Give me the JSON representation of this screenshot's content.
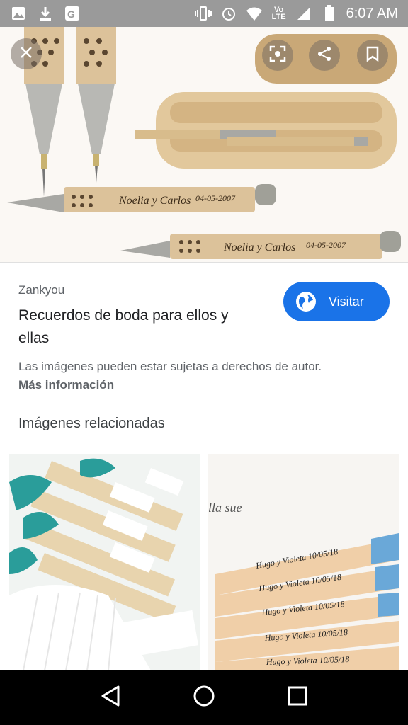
{
  "status_bar": {
    "time": "6:07 AM",
    "icons_left": [
      "image-icon",
      "download-icon",
      "google-settings-icon"
    ],
    "icons_right": [
      "vibrate-icon",
      "alarm-icon",
      "wifi-icon",
      "volte-icon",
      "signal-icon",
      "battery-icon"
    ],
    "volte_label": "Vo LTE"
  },
  "hero": {
    "engraving_1": "Noelia y Carlos",
    "date_1": "04-05-2007",
    "engraving_2": "Noelia y Carlos",
    "date_2": "04-05-2007"
  },
  "result": {
    "source": "Zankyou",
    "title": "Recuerdos de boda para ellos y ellas",
    "visit_label": "Visitar",
    "copyright": "Las imágenes pueden estar sujetas a derechos de autor.",
    "more_info": "Más información"
  },
  "related": {
    "heading": "Imágenes relacionadas",
    "thumb2_text": "lla sue",
    "fan_labels": [
      "Hugo y Violeta  10/05/18",
      "Hugo y Violeta  10/05/18",
      "Hugo y Violeta  10/05/18",
      "Hugo y Violeta  10/05/18",
      "Hugo y Violeta  10/05/18"
    ]
  },
  "colors": {
    "accent": "#1a73e8",
    "status_bar": "#9a9a9a",
    "nav_bar": "#000000",
    "wood": "#dcc29a",
    "teal_ribbon": "#2a9d9a"
  }
}
